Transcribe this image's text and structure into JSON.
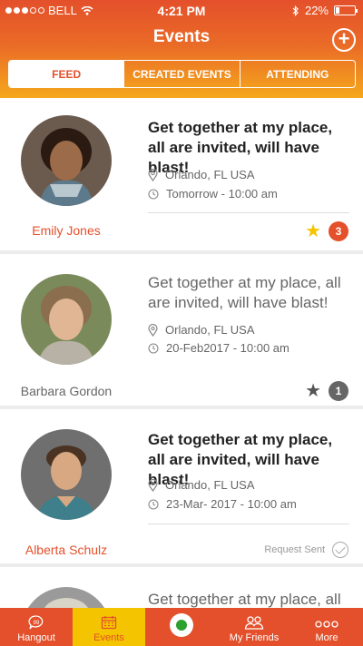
{
  "status": {
    "carrier": "BELL",
    "time": "4:21 PM",
    "battery": "22%",
    "battery_level": 0.22
  },
  "header": {
    "title": "Events",
    "add_icon": "plus-circle-icon"
  },
  "tabs": [
    {
      "label": "FEED",
      "active": true
    },
    {
      "label": "CREATED EVENTS",
      "active": false
    },
    {
      "label": "ATTENDING",
      "active": false
    }
  ],
  "events": [
    {
      "author": "Emily Jones",
      "title": "Get together at my place, all are invited, will have blast!",
      "location": "Orlando, FL USA",
      "datetime": "Tomorrow - 10:00 am",
      "starred": true,
      "count": "3"
    },
    {
      "author": "Barbara Gordon",
      "title": "Get together at my place, all are invited, will have blast!",
      "location": "Orlando, FL USA",
      "datetime": "20-Feb2017 - 10:00 am",
      "starred": false,
      "count": "1"
    },
    {
      "author": "Alberta Schulz",
      "title": "Get together at my place, all are invited, will have blast!",
      "location": "Orlando, FL USA",
      "datetime": "23-Mar- 2017 - 10:00 am",
      "status": "Request Sent"
    },
    {
      "title": "Get together at my place, all"
    }
  ],
  "nav": [
    {
      "label": "Hangout",
      "icon": "chat-bubble-icon"
    },
    {
      "label": "Events",
      "icon": "calendar-icon",
      "active": true
    },
    {
      "label": "",
      "icon": "green-dot-button"
    },
    {
      "label": "My Friends",
      "icon": "friends-icon"
    },
    {
      "label": "More",
      "icon": "more-dots-icon"
    }
  ],
  "colors": {
    "primary": "#e4502b",
    "accent": "#f5c400",
    "gradient_bottom": "#f5a81c",
    "online": "#2ca02c"
  }
}
